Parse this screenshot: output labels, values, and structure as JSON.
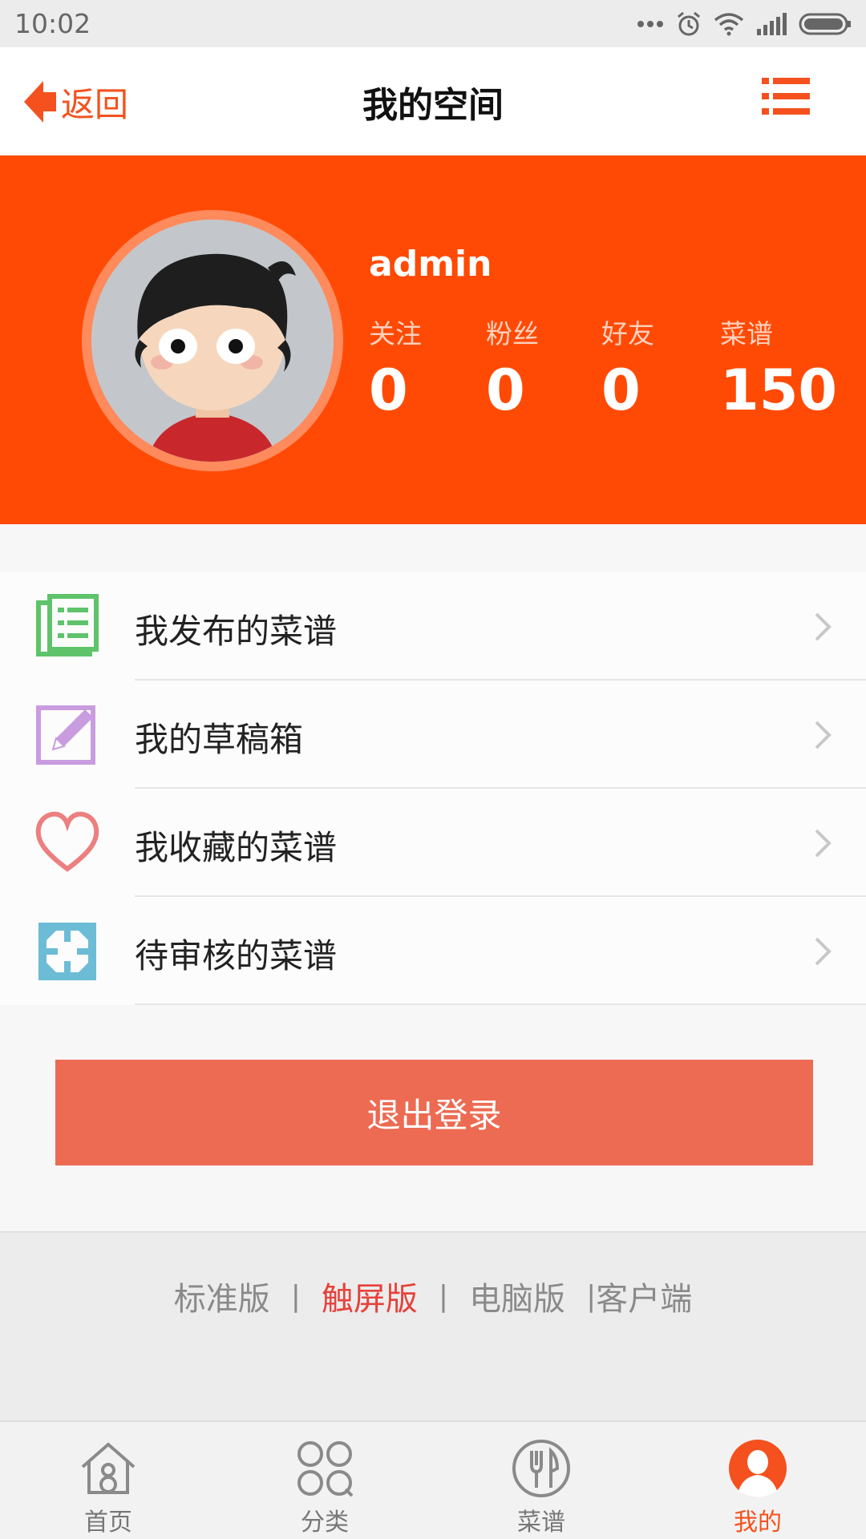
{
  "status_bar": {
    "time": "10:02"
  },
  "header": {
    "back_label": "返回",
    "title": "我的空间",
    "accent_color": "#f4511e"
  },
  "profile": {
    "username": "admin",
    "background_color": "#ff4a05",
    "stats": [
      {
        "label": "关注",
        "value": "0"
      },
      {
        "label": "粉丝",
        "value": "0"
      },
      {
        "label": "好友",
        "value": "0"
      },
      {
        "label": "菜谱",
        "value": "150"
      }
    ]
  },
  "menu": {
    "items": [
      {
        "label": "我发布的菜谱",
        "icon": "document-list-icon",
        "color": "#5ec36a"
      },
      {
        "label": "我的草稿箱",
        "icon": "pencil-edit-icon",
        "color": "#c99ce0"
      },
      {
        "label": "我收藏的菜谱",
        "icon": "heart-icon",
        "color": "#ec7f7f"
      },
      {
        "label": "待审核的菜谱",
        "icon": "pending-review-icon",
        "color": "#6cbcd6"
      }
    ]
  },
  "logout": {
    "label": "退出登录",
    "color": "#ec6b52"
  },
  "versions": {
    "links": [
      "标准版",
      "触屏版",
      "电脑版",
      "客户端"
    ],
    "active": "触屏版",
    "active_color": "#e5423b"
  },
  "tabbar": {
    "tabs": [
      {
        "label": "首页",
        "icon": "home-icon"
      },
      {
        "label": "分类",
        "icon": "category-icon"
      },
      {
        "label": "菜谱",
        "icon": "recipe-icon"
      },
      {
        "label": "我的",
        "icon": "profile-icon"
      }
    ],
    "active": "我的"
  }
}
